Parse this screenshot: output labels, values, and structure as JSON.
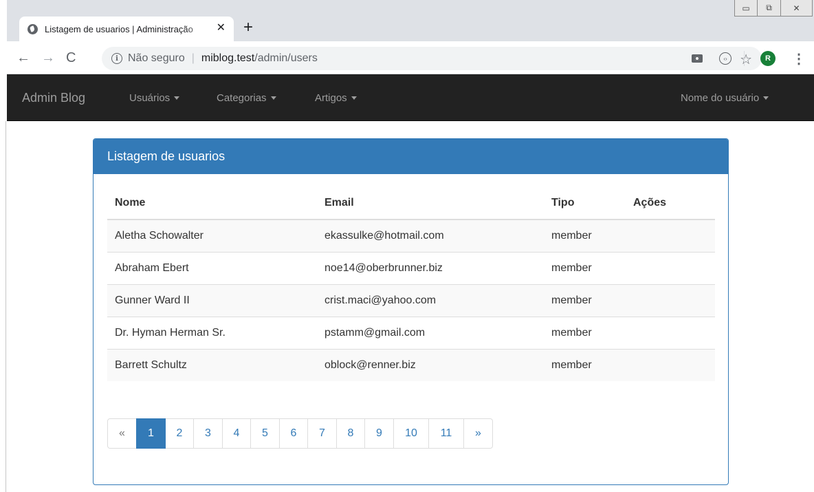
{
  "browser": {
    "tab_title": "Listagem de usuarios | Administração",
    "tab_close": "✕",
    "new_tab": "+",
    "security_label": "Não seguro",
    "url_host": "miblog.test",
    "url_path": "/admin/users",
    "avatar_initial": "R",
    "window_controls": {
      "minimize": "▭",
      "restore": "⧉",
      "close": "✕"
    }
  },
  "navbar": {
    "brand": "Admin Blog",
    "menus": [
      {
        "label": "Usuários"
      },
      {
        "label": "Categorias"
      },
      {
        "label": "Artigos"
      }
    ],
    "user_menu": "Nome do usuário"
  },
  "panel": {
    "title": "Listagem de usuarios",
    "columns": [
      "Nome",
      "Email",
      "Tipo",
      "Ações"
    ],
    "rows": [
      {
        "nome": "Aletha Schowalter",
        "email": "ekassulke@hotmail.com",
        "tipo": "member",
        "acoes": ""
      },
      {
        "nome": "Abraham Ebert",
        "email": "noe14@oberbrunner.biz",
        "tipo": "member",
        "acoes": ""
      },
      {
        "nome": "Gunner Ward II",
        "email": "crist.maci@yahoo.com",
        "tipo": "member",
        "acoes": ""
      },
      {
        "nome": "Dr. Hyman Herman Sr.",
        "email": "pstamm@gmail.com",
        "tipo": "member",
        "acoes": ""
      },
      {
        "nome": "Barrett Schultz",
        "email": "oblock@renner.biz",
        "tipo": "member",
        "acoes": ""
      }
    ]
  },
  "pagination": {
    "prev": "«",
    "next": "»",
    "pages": [
      "1",
      "2",
      "3",
      "4",
      "5",
      "6",
      "7",
      "8",
      "9",
      "10",
      "11"
    ],
    "current": "1"
  },
  "colors": {
    "primary": "#337ab7",
    "navbar_bg": "#222222",
    "navbar_text": "#9d9d9d",
    "chrome_bg": "#dee1e6"
  }
}
